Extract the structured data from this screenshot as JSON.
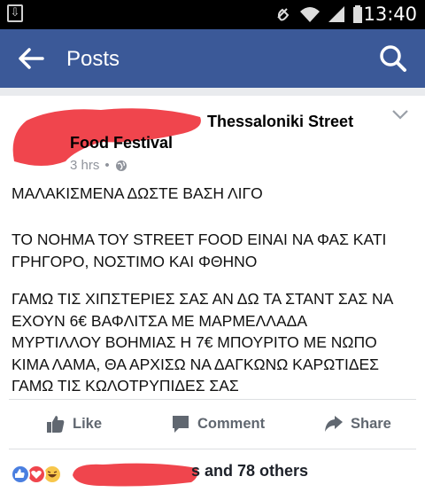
{
  "status_bar": {
    "time": "13:40"
  },
  "app_bar": {
    "title": "Posts"
  },
  "post": {
    "page_name_line1": "Thessaloniki Street",
    "page_name_line2": "Food Festival",
    "timestamp": "3 hrs",
    "paragraphs": [
      [
        "ΜΑΛΑΚΙΣΜΕΝΑ ΔΩΣΤΕ ΒΑΣΗ ΛΙΓΟ"
      ],
      [
        "ΤΟ ΝΟΗΜΑ ΤΟΥ STREET FOOD ΕΙΝΑΙ ΝΑ ΦΑΣ ΚΑΤΙ",
        "ΓΡΗΓΟΡΟ, ΝΟΣΤΙΜΟ ΚΑΙ ΦΘΗΝΟ"
      ],
      [
        "ΓΑΜΩ ΤΙΣ ΧΙΠΣΤΕΡΙΕΣ ΣΑΣ ΑΝ ΔΩ ΤΑ ΣΤΑΝΤ ΣΑΣ ΝΑ",
        "ΕΧΟΥΝ 6€ ΒΑΦΛΙΤΣΑ ΜΕ ΜΑΡΜΕΛΛΑΔΑ",
        "ΜΥΡΤΙΛΛΟΥ ΒΟΗΜΙΑΣ Η 7€ ΜΠΟΥΡΙΤΟ ΜΕ ΝΩΠΟ",
        "ΚΙΜΑ ΛΑΜΑ, ΘΑ ΑΡΧΙΣΩ ΝΑ ΔΑΓΚΩΝΩ ΚΑΡΩΤΙΔΕΣ",
        "ΓΑΜΩ ΤΙΣ ΚΩΛΟΤΡΥΠΙΔΕΣ ΣΑΣ"
      ]
    ]
  },
  "actions": {
    "like": "Like",
    "comment": "Comment",
    "share": "Share"
  },
  "reactions": {
    "summary_visible": "s and 78 others"
  },
  "colors": {
    "brand": "#3b5998",
    "redaction": "#f0454d",
    "muted": "#90949c"
  }
}
